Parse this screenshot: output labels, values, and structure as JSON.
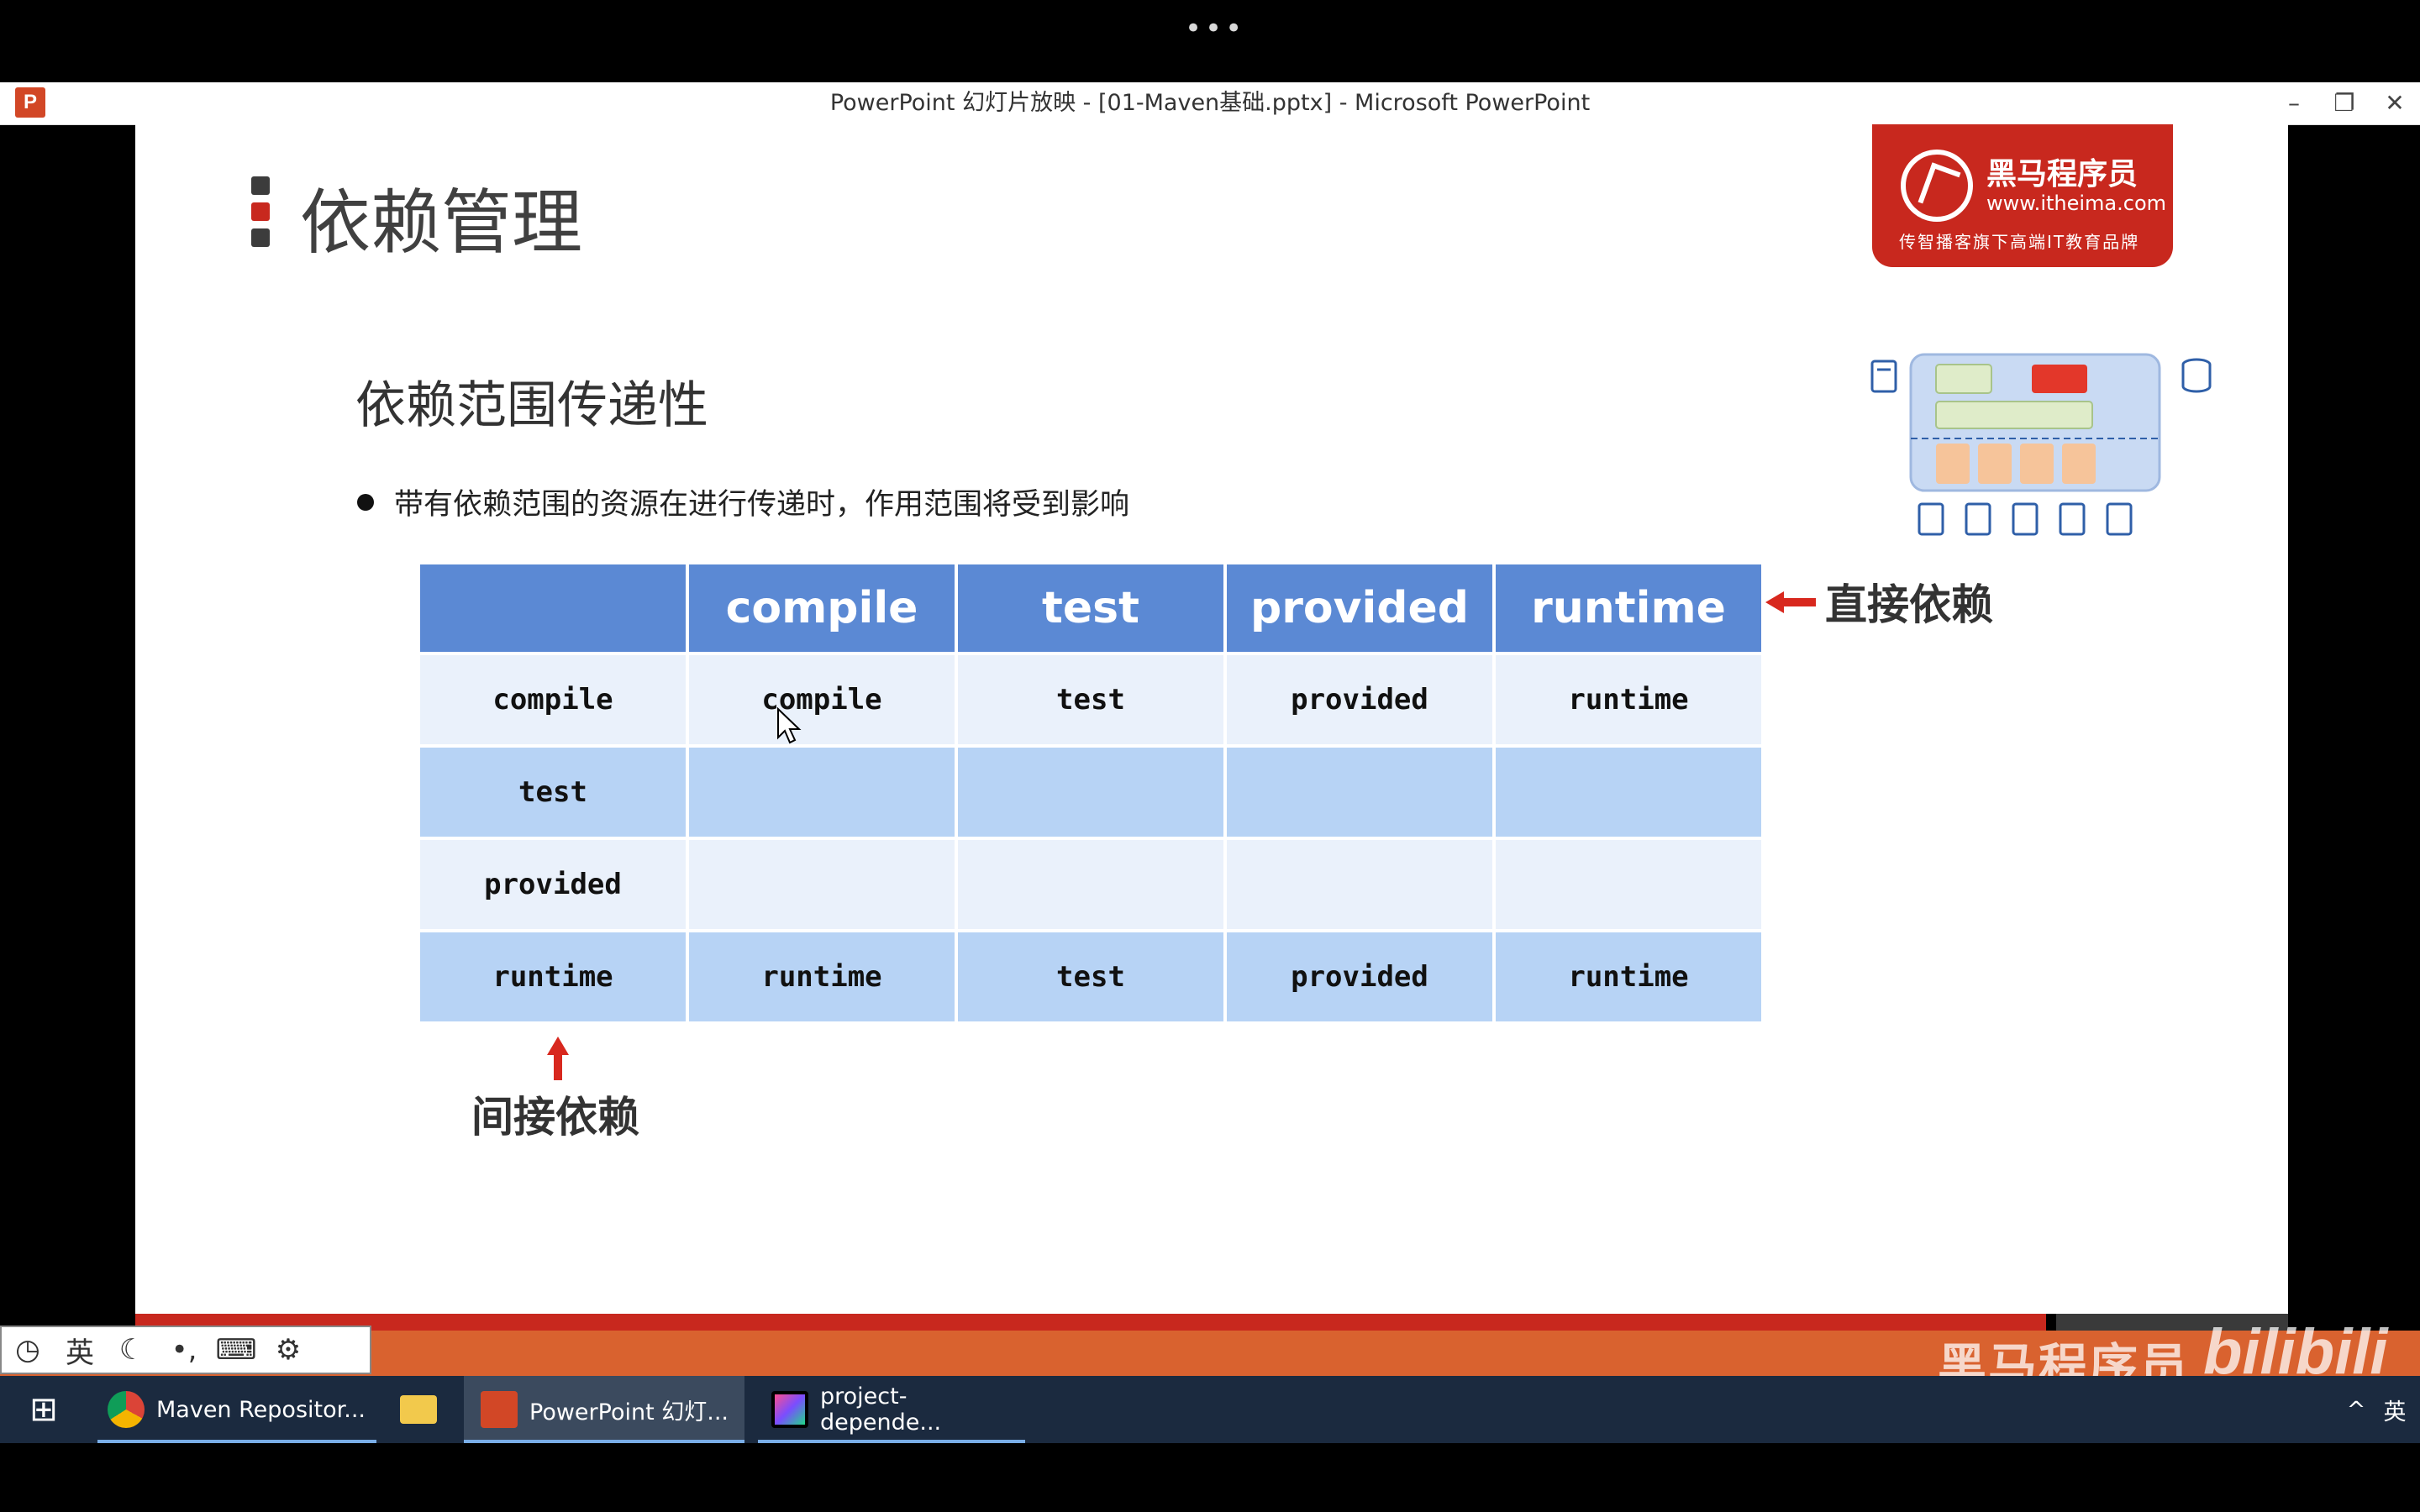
{
  "window": {
    "title": "PowerPoint 幻灯片放映 - [01-Maven基础.pptx] - Microsoft PowerPoint",
    "app_icon": "P",
    "minimize": "–",
    "restore": "❐",
    "close": "✕"
  },
  "topbar": {
    "menu_dots": "•••"
  },
  "slide": {
    "page_title": "依赖管理",
    "logo": {
      "name": "黑马程序员",
      "url": "www.itheima.com",
      "slogan": "传智播客旗下高端IT教育品牌"
    },
    "section_title": "依赖范围传递性",
    "bullet": "带有依赖范围的资源在进行传递时，作用范围将受到影响",
    "table": {
      "header": [
        "",
        "compile",
        "test",
        "provided",
        "runtime"
      ],
      "rows": [
        [
          "compile",
          "compile",
          "test",
          "provided",
          "runtime"
        ],
        [
          "test",
          "",
          "",
          "",
          ""
        ],
        [
          "provided",
          "",
          "",
          "",
          ""
        ],
        [
          "runtime",
          "runtime",
          "test",
          "provided",
          "runtime"
        ]
      ]
    },
    "direct_label": "直接依赖",
    "indirect_label": "间接依赖"
  },
  "ime": {
    "items": [
      "◷",
      "英",
      "☾",
      "•,",
      "⌨",
      "⚙"
    ]
  },
  "watermark": {
    "text": "黑马程序员",
    "bili": "bilibili"
  },
  "taskbar": {
    "start": "⊞",
    "items": [
      {
        "label": "Maven Repositor...",
        "icon": "chrome-icon"
      },
      {
        "label": "",
        "icon": "folder-icon"
      },
      {
        "label": "PowerPoint 幻灯...",
        "icon": "powerpoint-icon"
      },
      {
        "label": "project-depende...",
        "icon": "intellij-icon"
      }
    ],
    "tray_up": "^",
    "tray_lang": "英"
  },
  "colors": {
    "header_blue": "#5b89d4",
    "row_light": "#eaf1fb",
    "row_mid": "#b7d3f5",
    "brand_red": "#c8281e",
    "footer_orange": "#d9622f",
    "taskbar": "#1b2a3f"
  }
}
